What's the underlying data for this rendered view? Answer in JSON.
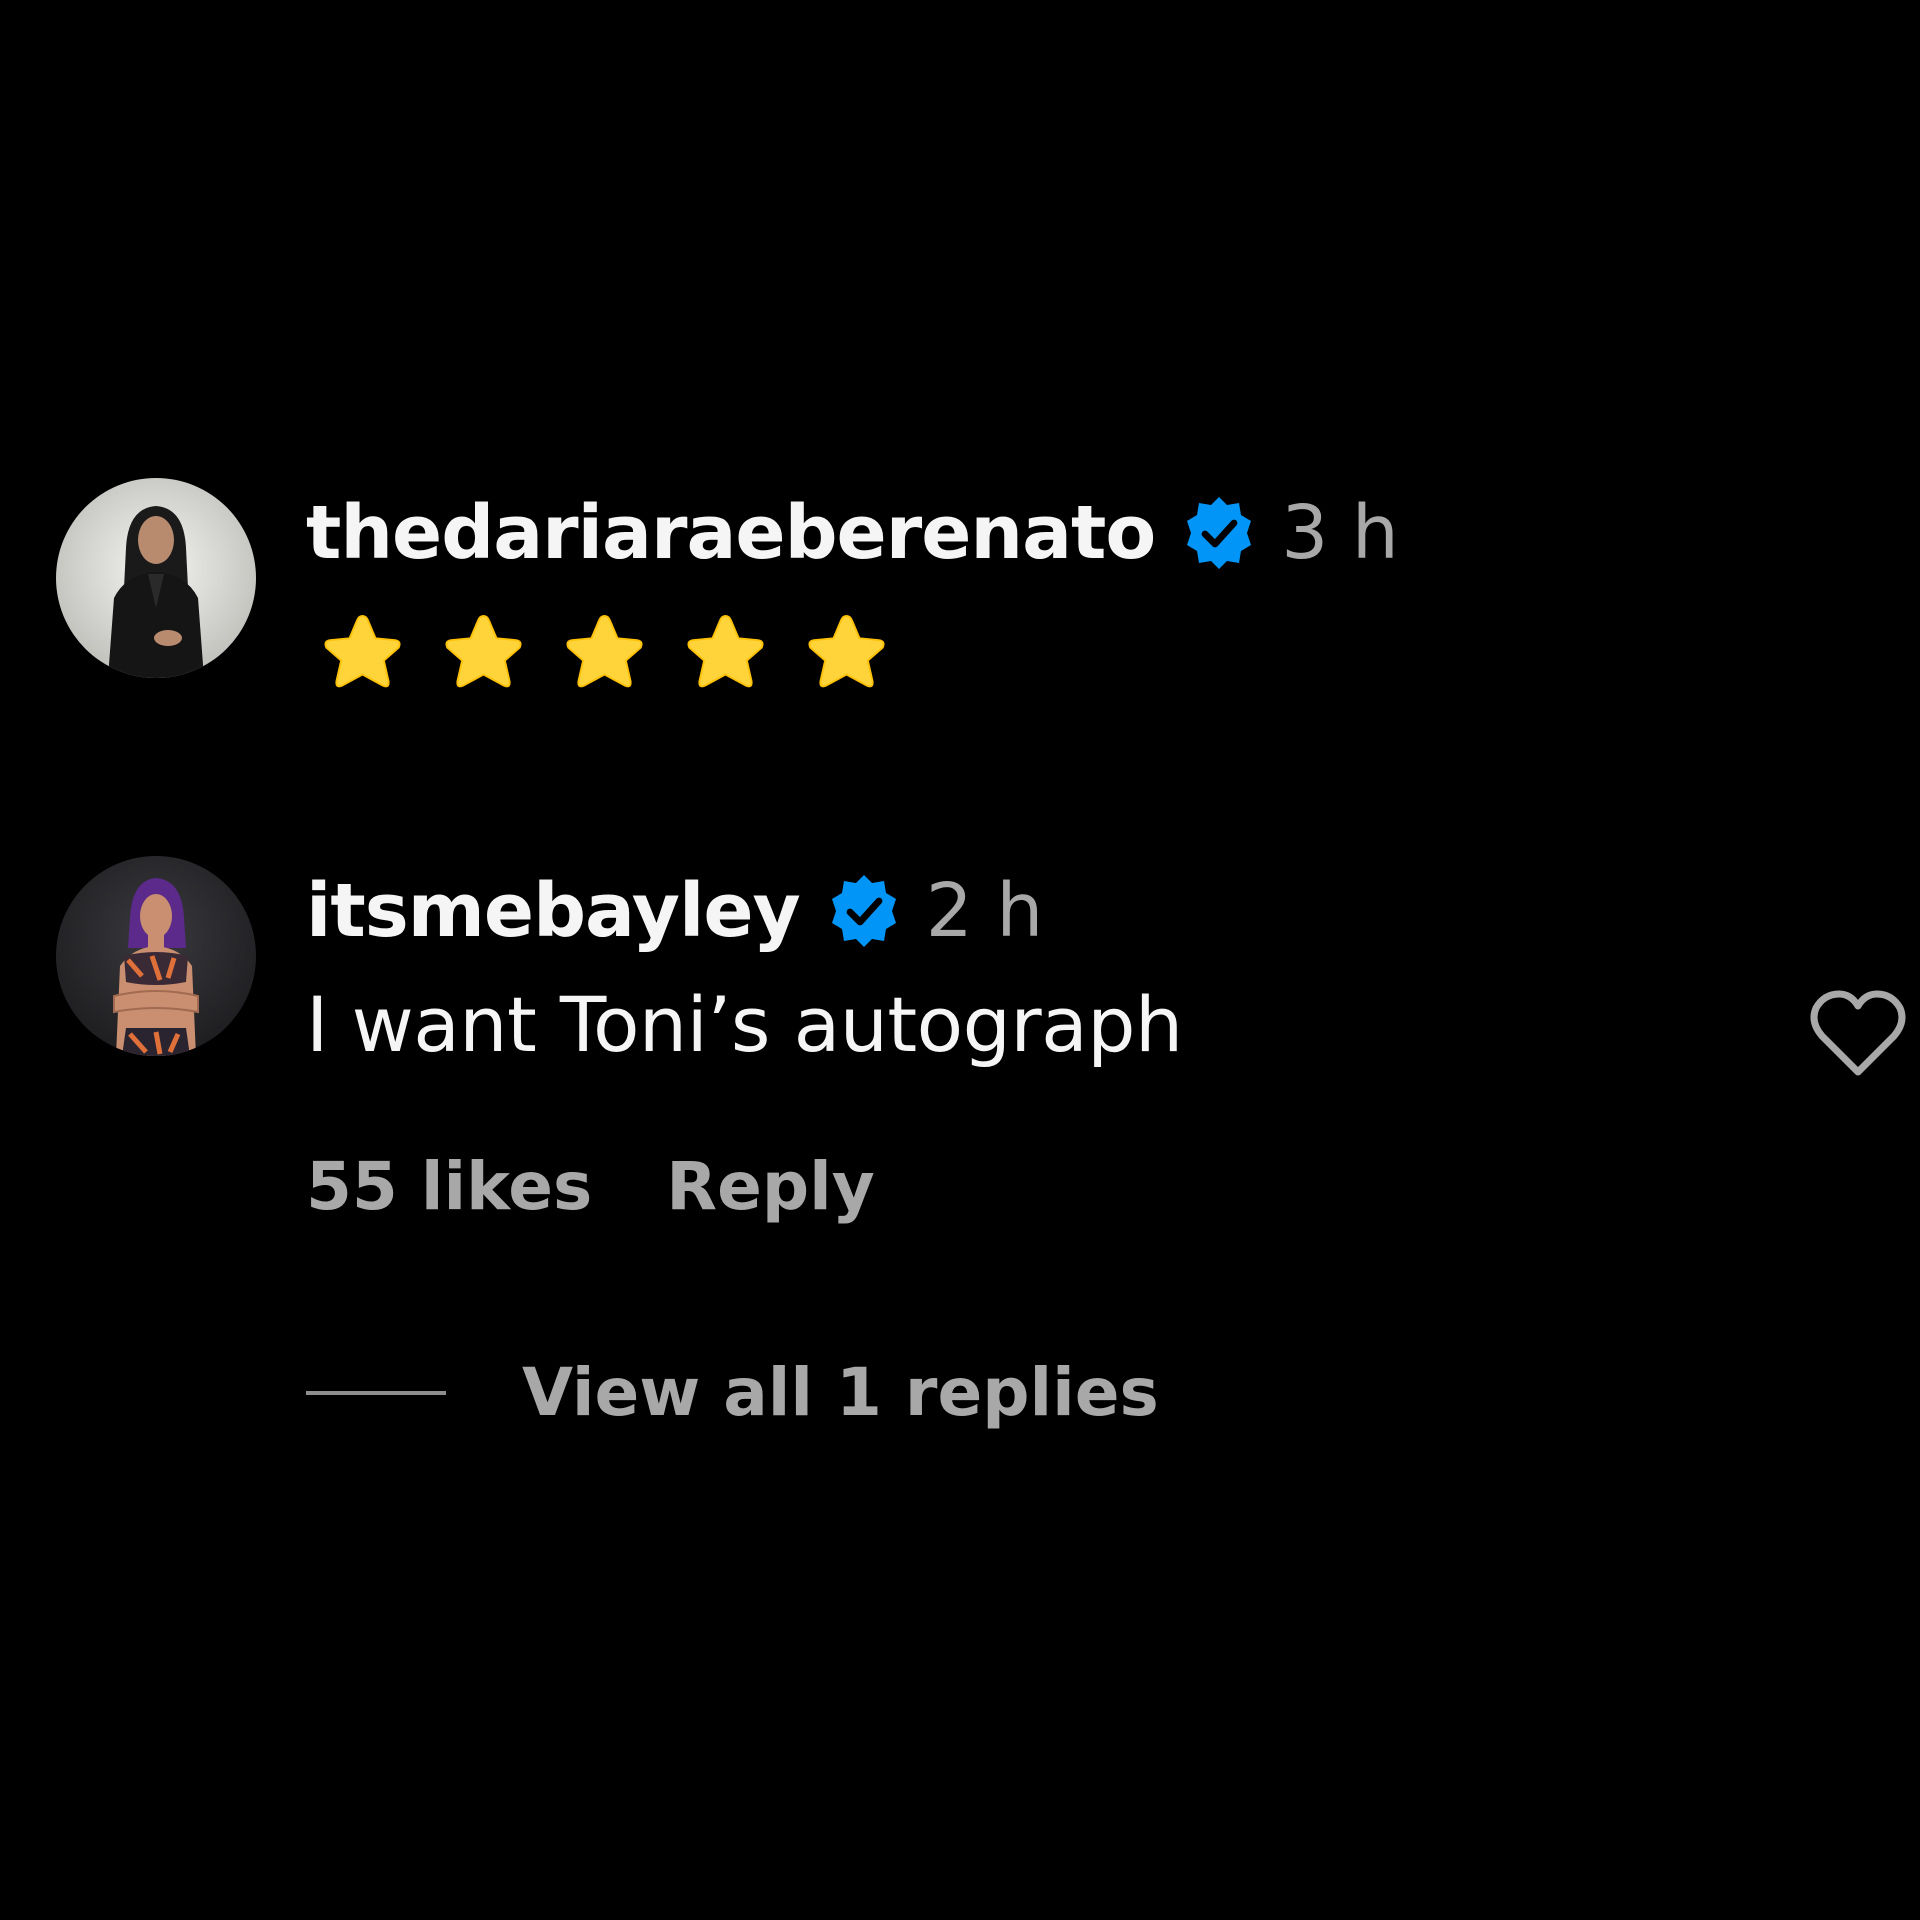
{
  "comments": [
    {
      "username": "thedariaraeberenato",
      "verified": true,
      "timestamp": "3 h",
      "content_emoji": "star",
      "content_count": 5
    },
    {
      "username": "itsmebayley",
      "verified": true,
      "timestamp": "2 h",
      "text": "I want Toni’s autograph",
      "likes_label": "55 likes",
      "reply_label": "Reply",
      "view_replies_label": "View all 1 replies"
    }
  ],
  "colors": {
    "background": "#000000",
    "username": "#f5f5f5",
    "secondary_text": "#a8a8a8",
    "verified_badge": "#0095f6",
    "star": "#ffd43b"
  },
  "icons": {
    "verified": "verified-badge-icon",
    "star": "star-emoji-icon",
    "like": "heart-outline-icon"
  }
}
